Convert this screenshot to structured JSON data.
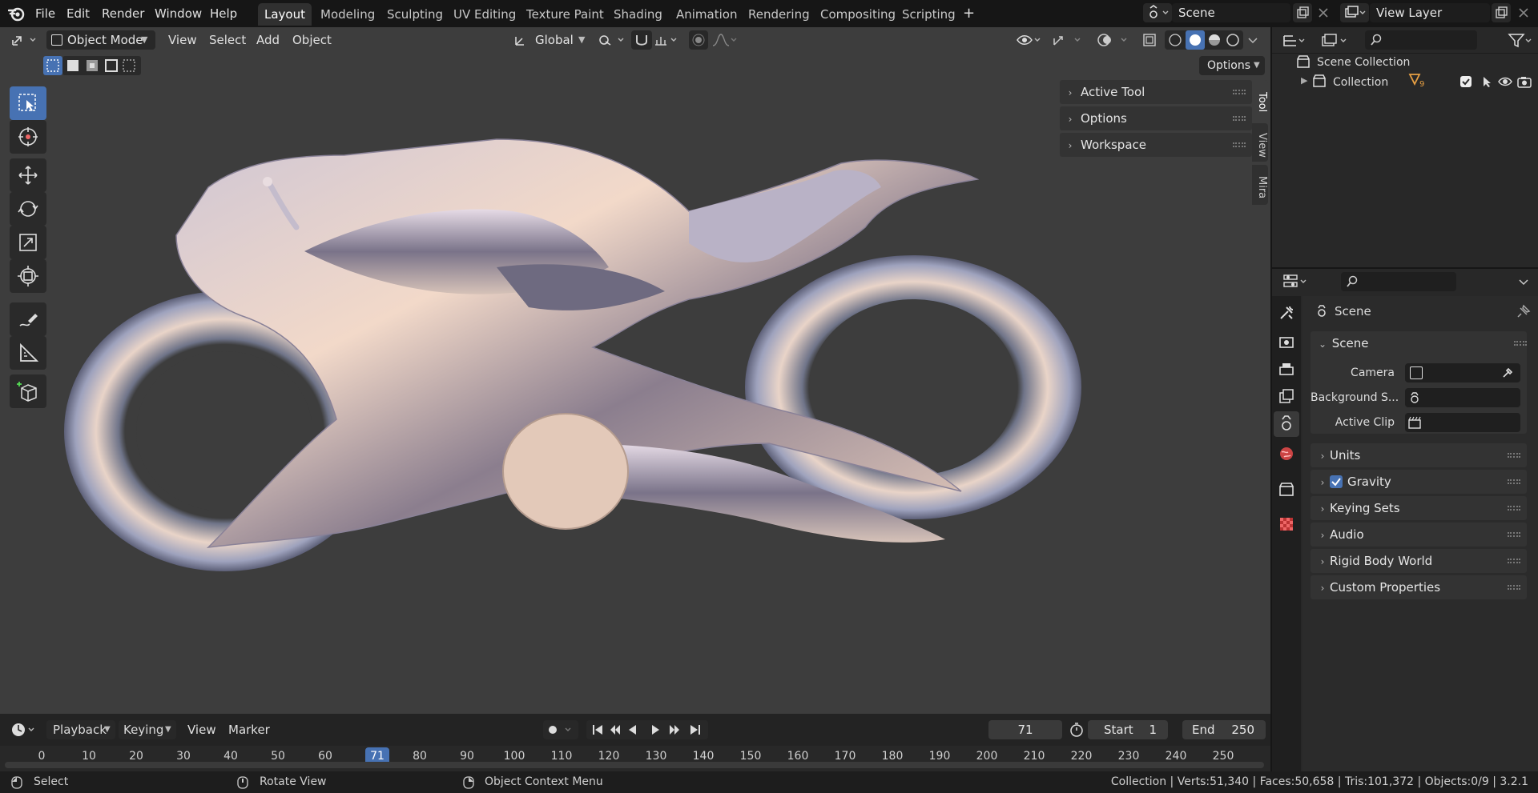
{
  "menu": {
    "file": "File",
    "edit": "Edit",
    "render": "Render",
    "window": "Window",
    "help": "Help"
  },
  "workspaces": [
    "Layout",
    "Modeling",
    "Sculpting",
    "UV Editing",
    "Texture Paint",
    "Shading",
    "Animation",
    "Rendering",
    "Compositing",
    "Scripting"
  ],
  "scene_name": "Scene",
  "view_layer": "View Layer",
  "viewport": {
    "mode": "Object Mode",
    "menus": [
      "View",
      "Select",
      "Add",
      "Object"
    ],
    "orientation": "Global",
    "options": "Options"
  },
  "npanel": {
    "sections": [
      "Active Tool",
      "Options",
      "Workspace"
    ],
    "tabs": [
      "Tool",
      "View",
      "Mira"
    ]
  },
  "outliner": {
    "root": "Scene Collection",
    "collection": "Collection",
    "badge": "9"
  },
  "properties": {
    "title": "Scene",
    "section": "Scene",
    "fields": [
      {
        "label": "Camera"
      },
      {
        "label": "Background S..."
      },
      {
        "label": "Active Clip"
      }
    ],
    "collapsed": [
      "Units",
      "Gravity",
      "Keying Sets",
      "Audio",
      "Rigid Body World",
      "Custom Properties"
    ],
    "gravity_checked": true
  },
  "timeline": {
    "menus": [
      "Playback",
      "Keying",
      "View",
      "Marker"
    ],
    "current_frame": "71",
    "start_label": "Start",
    "start": "1",
    "end_label": "End",
    "end": "250",
    "ticks": [
      "0",
      "10",
      "20",
      "30",
      "40",
      "50",
      "60",
      "71",
      "80",
      "90",
      "100",
      "110",
      "120",
      "130",
      "140",
      "150",
      "160",
      "170",
      "180",
      "190",
      "200",
      "210",
      "220",
      "230",
      "240",
      "250"
    ]
  },
  "status": {
    "select": "Select",
    "rotate": "Rotate View",
    "context": "Object Context Menu",
    "stats": "Collection | Verts:51,340 | Faces:50,658 | Tris:101,372 | Objects:0/9 | 3.2.1"
  },
  "colors": {
    "accent": "#4772b3",
    "viewport_bg": "#3d3d3d",
    "panel_bg": "#282828"
  }
}
